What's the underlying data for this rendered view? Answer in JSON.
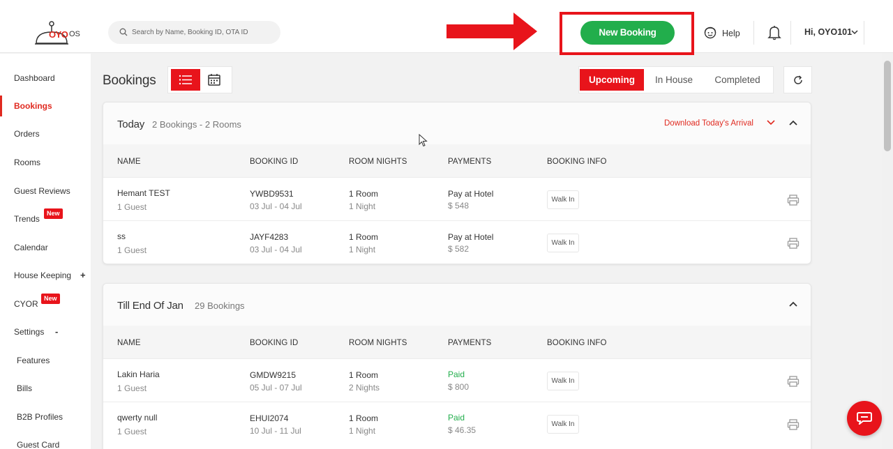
{
  "header": {
    "logo_text": "OYO",
    "logo_suffix": "OS",
    "search_placeholder": "Search by Name, Booking ID, OTA ID",
    "new_booking_label": "New Booking",
    "help_label": "Help",
    "user_label": "Hi, OYO101"
  },
  "sidebar": {
    "items": [
      {
        "label": "Dashboard"
      },
      {
        "label": "Bookings",
        "active": true
      },
      {
        "label": "Orders"
      },
      {
        "label": "Rooms"
      },
      {
        "label": "Guest Reviews"
      },
      {
        "label": "Trends",
        "badge": "New"
      },
      {
        "label": "Calendar"
      },
      {
        "label": "House Keeping",
        "extra": "+"
      },
      {
        "label": "CYOR",
        "badge": "New"
      },
      {
        "label": "Settings",
        "extra": "-"
      },
      {
        "label": "Features"
      },
      {
        "label": "Bills"
      },
      {
        "label": "B2B Profiles"
      },
      {
        "label": "Guest Card"
      }
    ]
  },
  "page": {
    "title": "Bookings",
    "tabs": [
      "Upcoming",
      "In House",
      "Completed"
    ],
    "active_tab": "Upcoming"
  },
  "columns": [
    "NAME",
    "BOOKING ID",
    "ROOM NIGHTS",
    "PAYMENTS",
    "BOOKING INFO"
  ],
  "sections": [
    {
      "title": "Today",
      "subtitle": "2 Bookings - 2 Rooms",
      "download_label": "Download Today's Arrival",
      "rows": [
        {
          "name": "Hemant TEST",
          "guests": "1 Guest",
          "booking_id": "YWBD9531",
          "dates": "03 Jul - 04 Jul",
          "rooms": "1 Room",
          "nights": "1 Night",
          "payment_status": "Pay at Hotel",
          "amount": "$ 548",
          "info": "Walk In"
        },
        {
          "name": "ss",
          "guests": "1 Guest",
          "booking_id": "JAYF4283",
          "dates": "03 Jul - 04 Jul",
          "rooms": "1 Room",
          "nights": "1 Night",
          "payment_status": "Pay at Hotel",
          "amount": "$ 582",
          "info": "Walk In"
        }
      ]
    },
    {
      "title": "Till End Of Jan",
      "subtitle": "29 Bookings",
      "rows": [
        {
          "name": "Lakin Haria",
          "guests": "1 Guest",
          "booking_id": "GMDW9215",
          "dates": "05 Jul - 07 Jul",
          "rooms": "1 Room",
          "nights": "2 Nights",
          "payment_status": "Paid",
          "amount": "$ 800",
          "info": "Walk In"
        },
        {
          "name": "qwerty null",
          "guests": "1 Guest",
          "booking_id": "EHUI2074",
          "dates": "10 Jul - 11 Jul",
          "rooms": "1 Room",
          "nights": "1 Night",
          "payment_status": "Paid",
          "amount": "$ 46.35",
          "info": "Walk In"
        }
      ]
    }
  ],
  "colors": {
    "brand_red": "#e8141b",
    "success_green": "#22ae4c"
  }
}
